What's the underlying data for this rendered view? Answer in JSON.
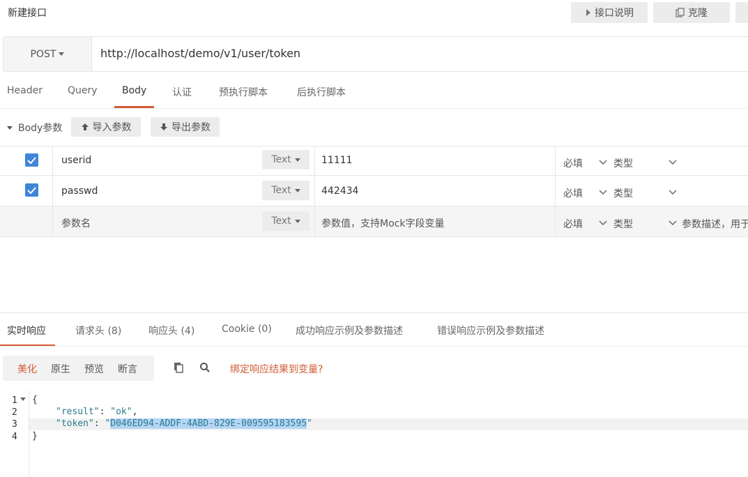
{
  "header": {
    "title": "新建接口",
    "api_doc_label": "接口说明",
    "clone_label": "克隆"
  },
  "request": {
    "method": "POST",
    "url": "http://localhost/demo/v1/user/token"
  },
  "tabs": [
    {
      "label": "Header"
    },
    {
      "label": "Query"
    },
    {
      "label": "Body"
    },
    {
      "label": "认证"
    },
    {
      "label": "预执行脚本"
    },
    {
      "label": "后执行脚本"
    }
  ],
  "active_tab": "Body",
  "body_params": {
    "section_label": "Body参数",
    "import_label": "导入参数",
    "export_label": "导出参数",
    "rows": [
      {
        "checked": true,
        "name": "userid",
        "type": "Text",
        "value": "11111",
        "required": "必填",
        "type_label": "类型"
      },
      {
        "checked": true,
        "name": "passwd",
        "type": "Text",
        "value": "442434",
        "required": "必填",
        "type_label": "类型"
      }
    ],
    "new_row": {
      "name_placeholder": "参数名",
      "type": "Text",
      "value_placeholder": "参数值，支持Mock字段变量",
      "required": "必填",
      "type_label": "类型",
      "desc_placeholder": "参数描述，用于"
    }
  },
  "response": {
    "tabs": [
      {
        "label": "实时响应"
      },
      {
        "label": "请求头 (8)"
      },
      {
        "label": "响应头 (4)"
      },
      {
        "label": "Cookie (0)"
      },
      {
        "label": "成功响应示例及参数描述"
      },
      {
        "label": "错误响应示例及参数描述"
      }
    ],
    "active_tab": "实时响应",
    "toolbar": {
      "pretty": "美化",
      "raw": "原生",
      "preview": "预览",
      "assert": "断言",
      "bind_link": "绑定响应结果到变量?"
    },
    "code": {
      "line_numbers": [
        "1",
        "2",
        "3",
        "4"
      ],
      "open_brace": "{",
      "result_key": "\"result\"",
      "result_value": "\"ok\"",
      "token_key": "\"token\"",
      "token_quote_open": "\"",
      "token_value": "D046ED94-ADDF-4ABD-829E-009595183595",
      "token_quote_close": "\"",
      "close_brace": "}"
    }
  },
  "colors": {
    "accent": "#d35b34",
    "checkbox": "#3f86d6",
    "json_string": "#2a7b8c",
    "selection": "#b5d5f5"
  },
  "icons": [
    "play-icon",
    "copy-icon",
    "caret-down-icon",
    "arrow-up-icon",
    "arrow-down-icon",
    "check-icon",
    "chevron-down-icon",
    "clipboard-icon",
    "search-icon"
  ]
}
